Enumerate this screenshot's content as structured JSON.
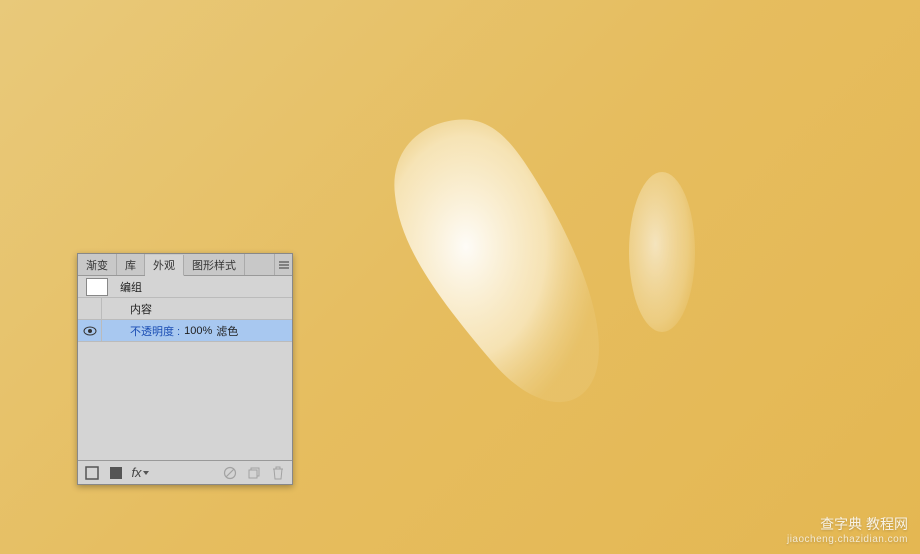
{
  "panel": {
    "tabs": [
      {
        "label": "渐变"
      },
      {
        "label": "库"
      },
      {
        "label": "外观"
      },
      {
        "label": "图形样式"
      }
    ],
    "active_tab_index": 2,
    "rows": {
      "group_label": "编组",
      "content_label": "内容",
      "opacity_label": "不透明度 :",
      "opacity_value": "100%",
      "blend_mode": "滤色"
    }
  },
  "watermark": {
    "title": "查字典  教程网",
    "url": "jiaocheng.chazidian.com"
  }
}
